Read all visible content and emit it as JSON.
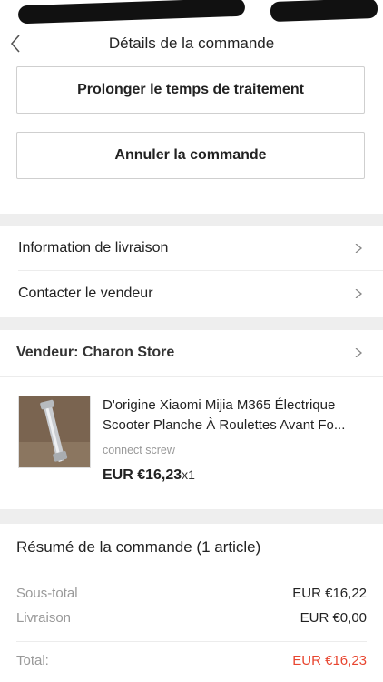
{
  "header": {
    "title": "Détails de la commande"
  },
  "actions": {
    "extend_label": "Prolonger le temps de traitement",
    "cancel_label": "Annuler la commande"
  },
  "links": {
    "delivery_info": "Information de livraison",
    "contact_seller": "Contacter le vendeur"
  },
  "vendor": {
    "label": "Vendeur: Charon Store"
  },
  "product": {
    "title": "D'origine Xiaomi Mijia M365 Électrique Scooter Planche À Roulettes Avant Fo...",
    "variant": "connect screw",
    "price": "EUR €16,23",
    "quantity": "x1"
  },
  "summary": {
    "title": "Résumé de la commande (1 article)",
    "subtotal_label": "Sous-total",
    "subtotal_value": "EUR €16,22",
    "shipping_label": "Livraison",
    "shipping_value": "EUR €0,00",
    "total_label": "Total:",
    "total_value": "EUR €16,23"
  },
  "colors": {
    "accent": "#e8452f",
    "muted": "#999999",
    "separator": "#eeeeee"
  }
}
